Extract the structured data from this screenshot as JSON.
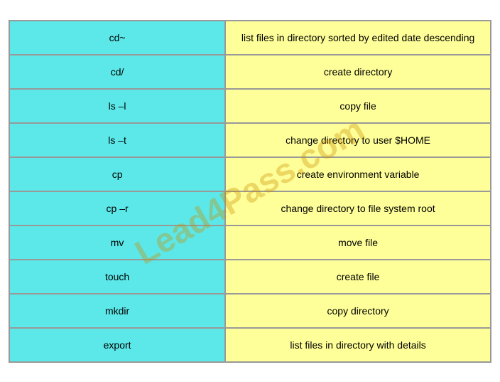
{
  "rows": [
    {
      "left": "cd~",
      "right": "list files in directory sorted by edited date descending"
    },
    {
      "left": "cd/",
      "right": "create directory"
    },
    {
      "left": "ls –l",
      "right": "copy file"
    },
    {
      "left": "ls –t",
      "right": "change directory to user $HOME"
    },
    {
      "left": "cp",
      "right": "create environment variable"
    },
    {
      "left": "cp –r",
      "right": "change directory to file system root"
    },
    {
      "left": "mv",
      "right": "move file"
    },
    {
      "left": "touch",
      "right": "create file"
    },
    {
      "left": "mkdir",
      "right": "copy directory"
    },
    {
      "left": "export",
      "right": "list files in directory with details"
    }
  ],
  "watermark": "Lead4Pass.com"
}
